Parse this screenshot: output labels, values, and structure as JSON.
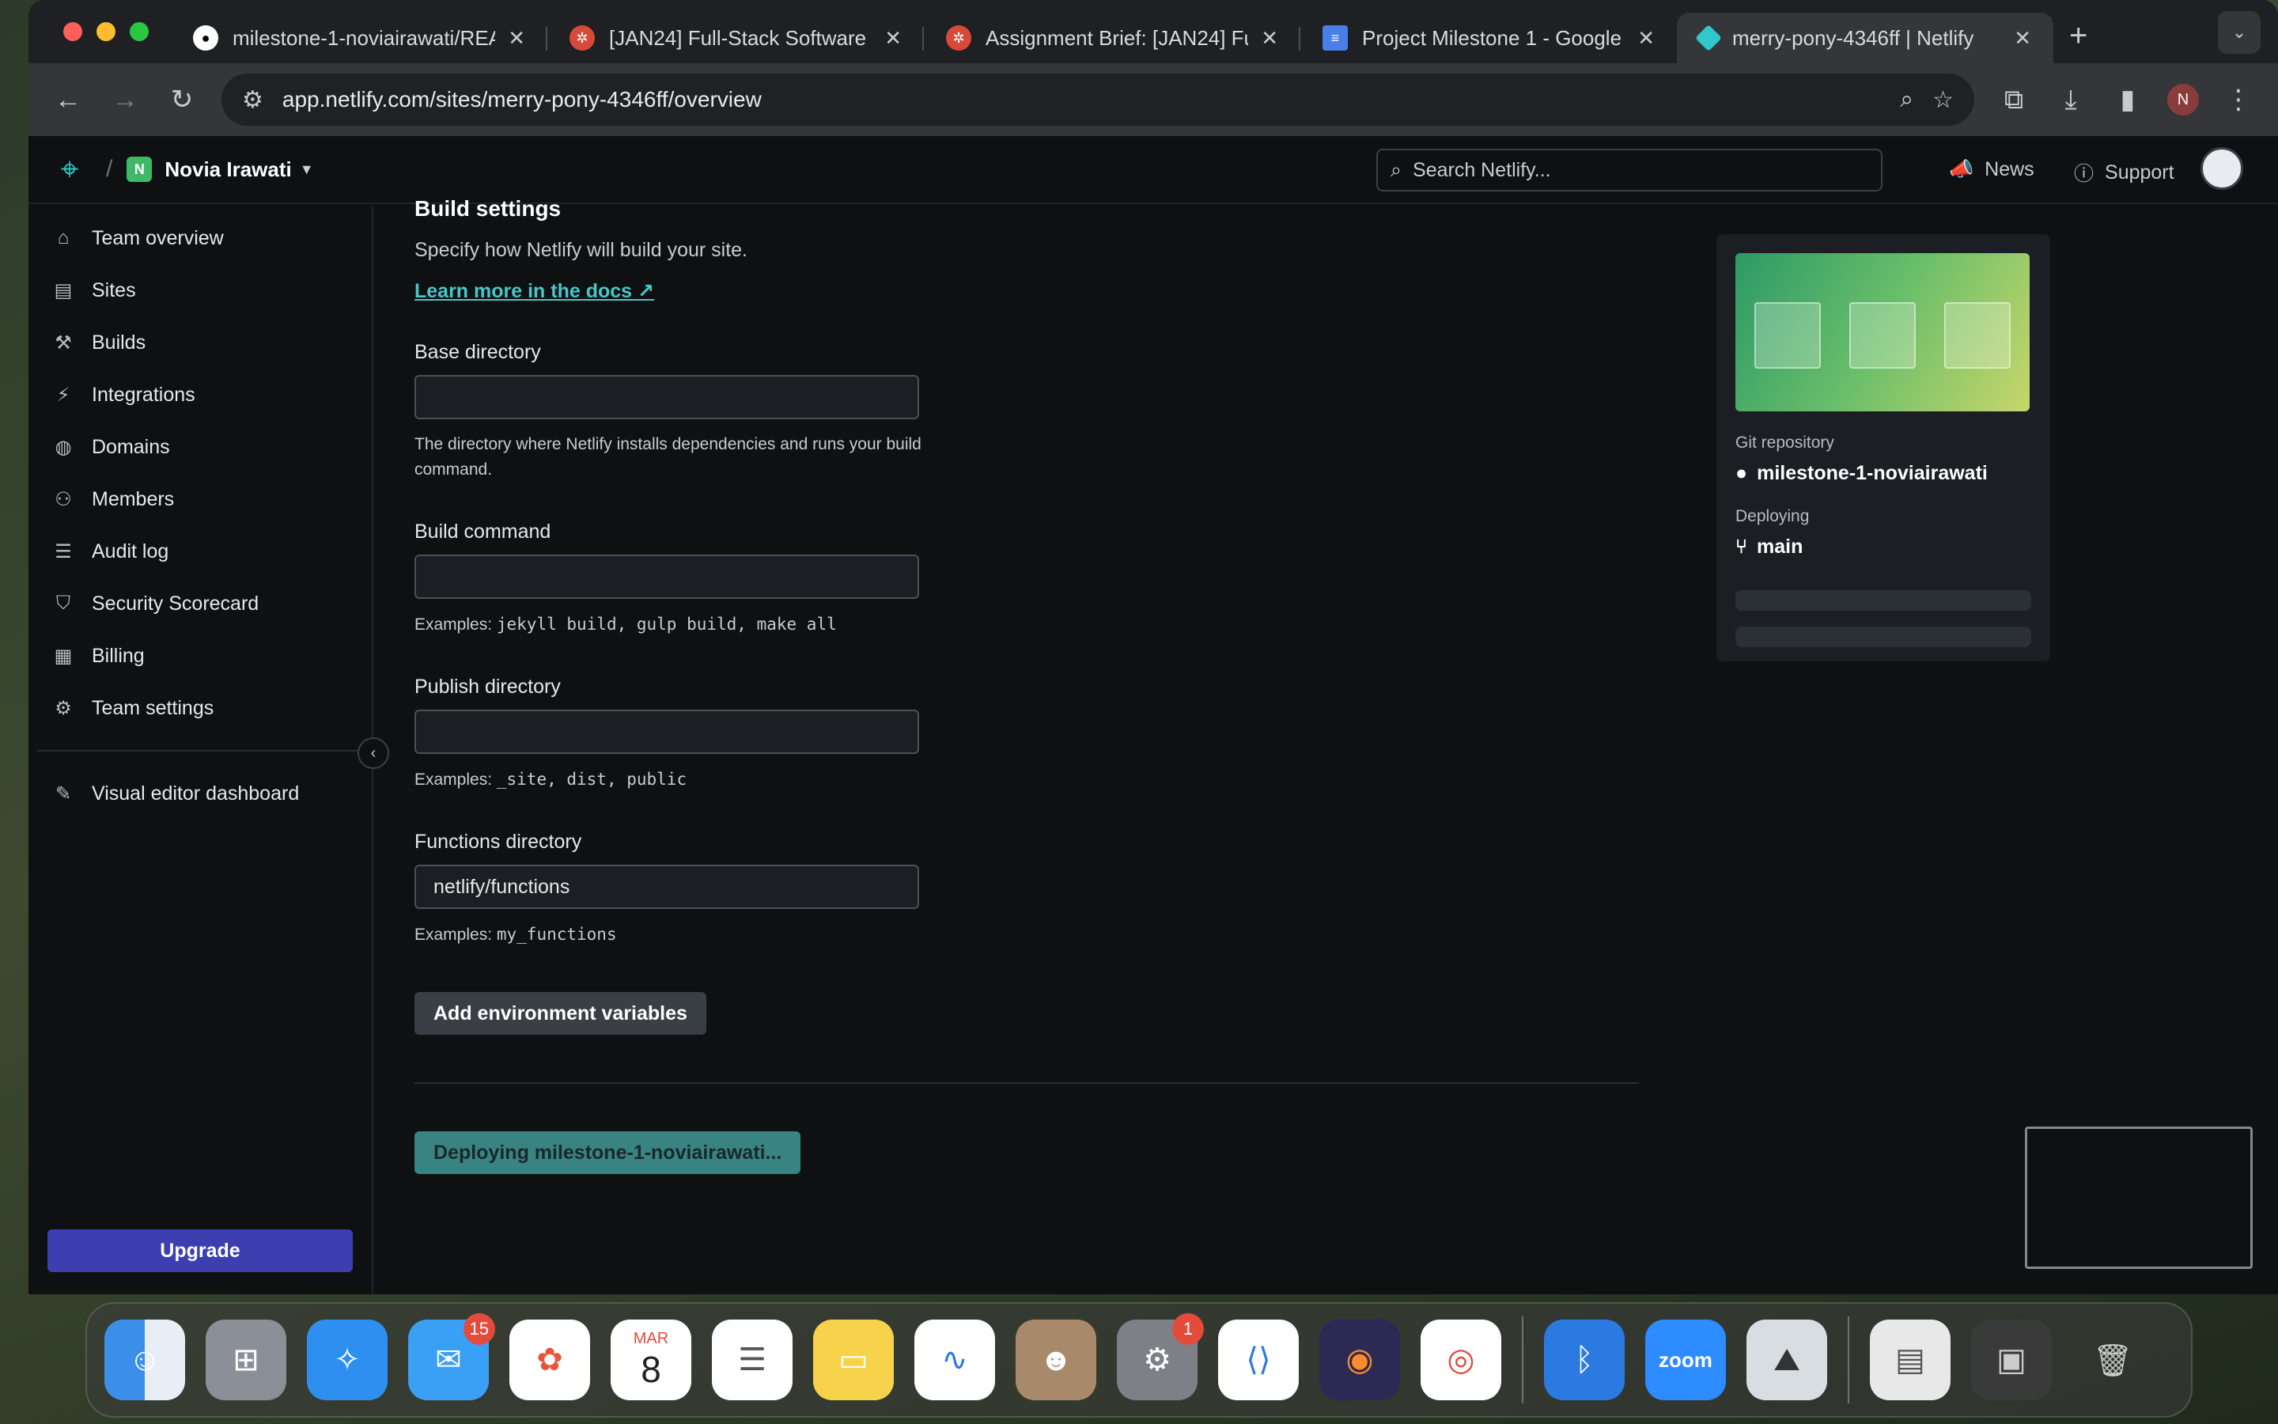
{
  "browser": {
    "tabs": [
      {
        "title": "milestone-1-noviairawati/REA",
        "icon": "github-icon",
        "active": false
      },
      {
        "title": "[JAN24] Full-Stack Software",
        "icon": "course-icon",
        "active": false
      },
      {
        "title": "Assignment Brief: [JAN24] Fu",
        "icon": "course-icon",
        "active": false
      },
      {
        "title": "Project Milestone 1 - Google I",
        "icon": "google-docs-icon",
        "active": false
      },
      {
        "title": "merry-pony-4346ff | Netlify",
        "icon": "netlify-icon",
        "active": true
      }
    ],
    "url": "app.netlify.com/sites/merry-pony-4346ff/overview",
    "profile_initial": "N"
  },
  "header": {
    "team_initial": "N",
    "team_name": "Novia Irawati",
    "search_placeholder": "Search Netlify...",
    "news_label": "News",
    "support_label": "Support"
  },
  "sidebar": {
    "items": [
      {
        "label": "Team overview",
        "icon": "home-icon"
      },
      {
        "label": "Sites",
        "icon": "sites-icon"
      },
      {
        "label": "Builds",
        "icon": "builds-icon"
      },
      {
        "label": "Integrations",
        "icon": "plug-icon"
      },
      {
        "label": "Domains",
        "icon": "globe-icon"
      },
      {
        "label": "Members",
        "icon": "members-icon"
      },
      {
        "label": "Audit log",
        "icon": "audit-log-icon"
      },
      {
        "label": "Security Scorecard",
        "icon": "shield-icon"
      },
      {
        "label": "Billing",
        "icon": "billing-icon"
      },
      {
        "label": "Team settings",
        "icon": "gear-icon"
      }
    ],
    "visual_editor_label": "Visual editor dashboard",
    "upgrade_label": "Upgrade"
  },
  "build_settings": {
    "title": "Build settings",
    "description": "Specify how Netlify will build your site.",
    "docs_link": "Learn more in the docs ↗",
    "base_directory": {
      "label": "Base directory",
      "value": "",
      "help": "The directory where Netlify installs dependencies and runs your build command."
    },
    "build_command": {
      "label": "Build command",
      "value": "",
      "help_prefix": "Examples: ",
      "help_code": "jekyll build, gulp build, make all"
    },
    "publish_directory": {
      "label": "Publish directory",
      "value": "",
      "help_prefix": "Examples: ",
      "help_code": "_site, dist, public"
    },
    "functions_directory": {
      "label": "Functions directory",
      "value": "netlify/functions",
      "help_prefix": "Examples: ",
      "help_code": "my_functions"
    },
    "env_button": "Add environment variables",
    "deploy_button": "Deploying milestone-1-noviairawati..."
  },
  "site_card": {
    "git_repo_label": "Git repository",
    "git_repo_value": "milestone-1-noviairawati",
    "deploying_label": "Deploying",
    "deploying_value": "main"
  },
  "dock": {
    "mail_badge": "15",
    "calendar_month": "MAR",
    "calendar_day": "8",
    "settings_badge": "1",
    "zoom_label": "zoom"
  },
  "colors": {
    "accent_teal": "#30c8c9",
    "upgrade_purple": "#3d3eb0",
    "team_badge_green": "#3fb968"
  }
}
